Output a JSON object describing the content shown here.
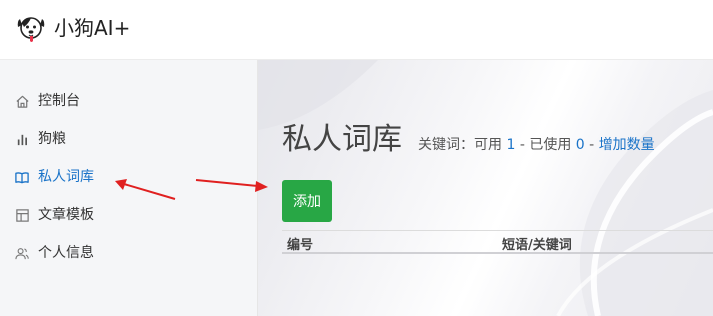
{
  "app": {
    "title": "小狗AI+",
    "logo_icon": "dog-logo-icon"
  },
  "sidebar": {
    "items": [
      {
        "label": "控制台",
        "icon": "home-icon",
        "active": false
      },
      {
        "label": "狗粮",
        "icon": "bar-chart-icon",
        "active": false
      },
      {
        "label": "私人词库",
        "icon": "book-icon",
        "active": true
      },
      {
        "label": "文章模板",
        "icon": "template-icon",
        "active": false
      },
      {
        "label": "个人信息",
        "icon": "user-icon",
        "active": false
      }
    ]
  },
  "main": {
    "title": "私人词库",
    "quota": {
      "prefix": "关键词：可用",
      "available": "1",
      "middle": "- 已使用",
      "used": "0",
      "dash": "-",
      "link_label": "增加数量"
    },
    "add_button": "添加",
    "table": {
      "columns": [
        "编号",
        "短语/关键词"
      ]
    }
  },
  "colors": {
    "accent": "#1a73c8",
    "add_button": "#28a745",
    "annotation_arrow": "#e02020",
    "sidebar_bg": "#f5f6f8"
  }
}
